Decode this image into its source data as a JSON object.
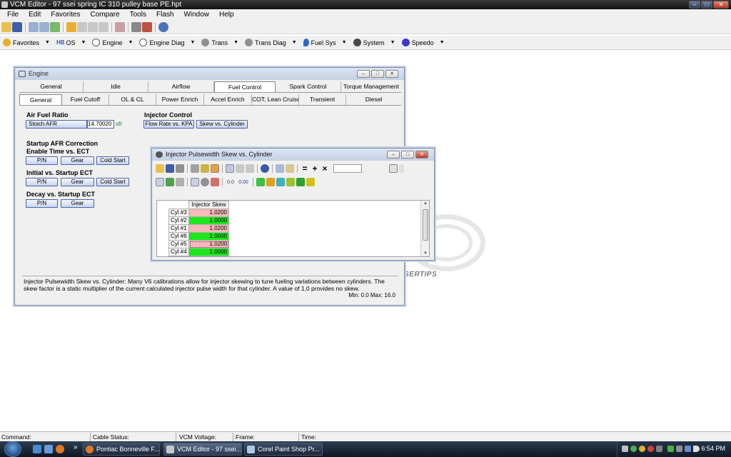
{
  "window": {
    "title": "VCM Editor - 97 ssei spring IC 310 pulley base PE.hpt"
  },
  "menu": [
    "File",
    "Edit",
    "Favorites",
    "Compare",
    "Tools",
    "Flash",
    "Window",
    "Help"
  ],
  "nav": [
    {
      "label": "Favorites",
      "icon": "star-icon",
      "color": "#e8b020"
    },
    {
      "label": "OS",
      "icon": "os-icon",
      "color": "#3060c0"
    },
    {
      "label": "Engine",
      "icon": "engine-icon",
      "color": "#606060"
    },
    {
      "label": "Engine Diag",
      "icon": "engine-diag-icon",
      "color": "#606060"
    },
    {
      "label": "Trans",
      "icon": "trans-icon",
      "color": "#707070"
    },
    {
      "label": "Trans Diag",
      "icon": "trans-diag-icon",
      "color": "#707070"
    },
    {
      "label": "Fuel Sys",
      "icon": "fuel-drop-icon",
      "color": "#2f66c8"
    },
    {
      "label": "System",
      "icon": "system-icon",
      "color": "#4a4a4a"
    },
    {
      "label": "Speedo",
      "icon": "speedo-icon",
      "color": "#3a3ad0"
    }
  ],
  "os_prefix": "HB",
  "engine_window": {
    "title": "Engine",
    "tabs_primary": [
      "General",
      "Idle",
      "Airflow",
      "Fuel Control",
      "Spark Control",
      "Torque Management"
    ],
    "tabs_primary_active": 3,
    "tabs_secondary": [
      "General",
      "Fuel Cutoff",
      "OL & CL",
      "Power Enrich",
      "Accel Enrich",
      "COT, Lean Cruise",
      "Transient",
      "Diesel"
    ],
    "tabs_secondary_active": 0,
    "air_fuel_ratio": {
      "heading": "Air Fuel Ratio",
      "label": "Stoich AFR",
      "value": "14.70020",
      "unit": "afr"
    },
    "injector_control": {
      "heading": "Injector Control",
      "btn_flow": "Flow Rate vs. KPA",
      "btn_skew": "Skew vs. Cylinder"
    },
    "startup": {
      "heading": "Startup AFR Correction",
      "enable_heading": "Enable Time vs. ECT",
      "initial_heading": "Initial vs. Startup ECT",
      "decay_heading": "Decay vs. Startup ECT",
      "btn_pn": "P/N",
      "btn_gear": "Gear",
      "btn_cold": "Cold Start"
    },
    "description": "Injector Pulsewidth Skew vs. Cylinder: Many V6 calibrations allow for injector skewing to tune fueling variations between cylinders. The skew factor is a static multiplier of the current calculated injector pulse width for that cylinder. A value of 1.0 provides no skew.",
    "minmax": "Min: 0.0  Max: 16.0"
  },
  "skew_window": {
    "title": "Injector Pulsewidth Skew vs. Cylinder",
    "column_header": "Injector Skew",
    "rows": [
      {
        "label": "Cyl #3",
        "value": "1.0200",
        "color": "#f6b8b8"
      },
      {
        "label": "Cyl #2",
        "value": "1.0000",
        "color": "#1ee61e"
      },
      {
        "label": "Cyl #1",
        "value": "1.0200",
        "color": "#f6b8b8"
      },
      {
        "label": "Cyl #6",
        "value": "1.0000",
        "color": "#1ee61e"
      },
      {
        "label": "Cyl #5",
        "value": "1.0200",
        "color": "#f6b8b8"
      },
      {
        "label": "Cyl #4",
        "value": "1.0000",
        "color": "#1ee61e"
      }
    ],
    "symbol_equal": "=",
    "symbol_plus": "+",
    "symbol_times": "×",
    "label_00": "0.0",
    "label_000": "0.00"
  },
  "watermark": {
    "text": "SERTIPS"
  },
  "statusbar": {
    "command": "Command:",
    "cable": "Cable Status:",
    "voltage": "VCM Voltage:",
    "frame": "Frame:",
    "time": "Time:"
  },
  "taskbar": {
    "tasks": [
      "Pontiac Bonneville F...",
      "VCM Editor - 97 ssei...",
      "Corel Paint Shop Pr..."
    ],
    "active_task": 1,
    "clock": "6:54 PM",
    "chevron": "»"
  }
}
